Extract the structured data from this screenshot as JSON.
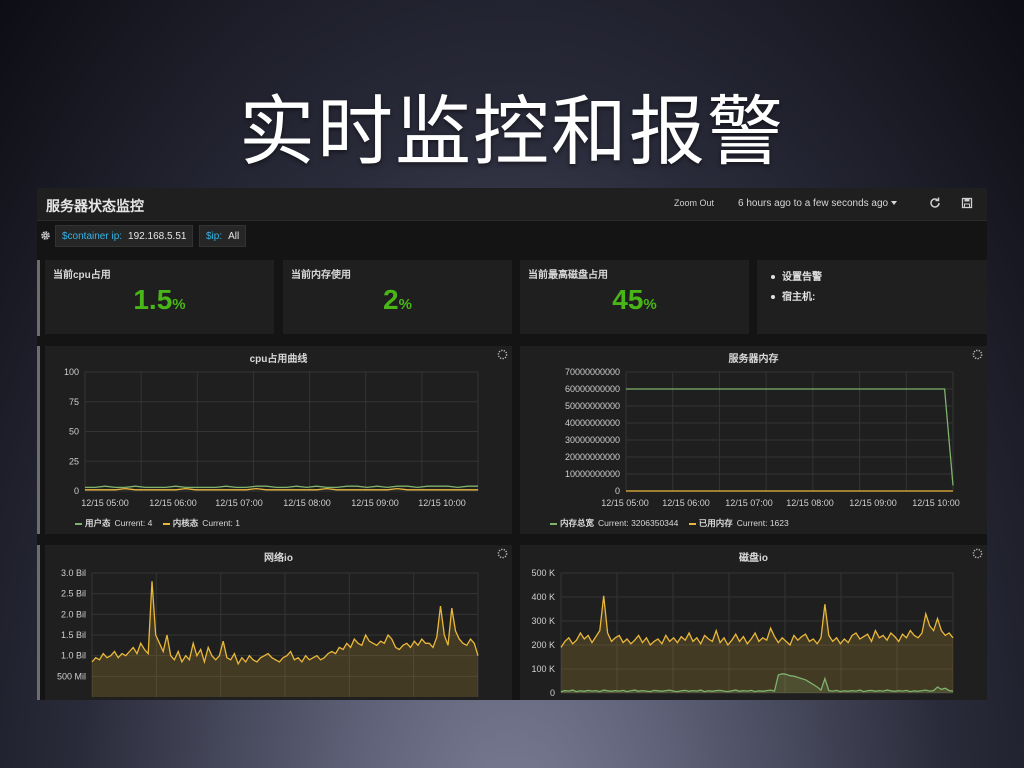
{
  "slide": {
    "title": "实时监控和报警"
  },
  "navbar": {
    "dashboard_title": "服务器状态监控",
    "zoom_out": "Zoom Out",
    "time_range": "6 hours ago to a few seconds ago",
    "refresh_icon": "refresh-icon",
    "save_icon": "save-icon"
  },
  "variables": [
    {
      "label": "$container ip:",
      "value": "192.168.5.51"
    },
    {
      "label": "$ip:",
      "value": "All"
    }
  ],
  "stats": [
    {
      "title": "当前cpu占用",
      "value": "1.5",
      "unit": "%"
    },
    {
      "title": "当前内存使用",
      "value": "2",
      "unit": "%"
    },
    {
      "title": "当前最高磁盘占用",
      "value": "45",
      "unit": "%"
    }
  ],
  "alerts": {
    "items": [
      "设置告警",
      "宿主机:"
    ]
  },
  "colors": {
    "green": "#7eb26d",
    "yellow": "#eab839",
    "stat": "#49b617"
  },
  "chart_data": [
    {
      "id": "cpu",
      "type": "line",
      "title": "cpu占用曲线",
      "ylim": [
        0,
        100
      ],
      "yticks": [
        "100",
        "75",
        "50",
        "25",
        "0"
      ],
      "xticks": [
        "12/15 05:00",
        "12/15 06:00",
        "12/15 07:00",
        "12/15 08:00",
        "12/15 09:00",
        "12/15 10:00"
      ],
      "series": [
        {
          "name": "用户态",
          "current": "Current: 4",
          "color": "#7eb26d",
          "values": [
            3,
            3,
            4,
            3,
            3,
            4,
            3,
            3,
            3,
            4,
            3,
            3,
            3,
            3,
            4,
            3,
            3,
            4,
            4,
            3,
            3,
            4,
            3,
            4,
            3,
            3,
            4,
            4,
            3,
            4,
            3,
            4,
            4,
            3,
            4,
            4,
            4,
            3,
            4,
            4
          ]
        },
        {
          "name": "内核态",
          "current": "Current: 1",
          "color": "#eab839",
          "values": [
            1,
            1,
            1,
            1,
            2,
            1,
            1,
            1,
            1,
            1,
            2,
            1,
            1,
            1,
            1,
            1,
            1,
            2,
            1,
            1,
            1,
            1,
            1,
            1,
            2,
            1,
            1,
            1,
            1,
            1,
            1,
            2,
            1,
            1,
            1,
            1,
            1,
            1,
            1,
            1
          ]
        }
      ]
    },
    {
      "id": "mem",
      "type": "line",
      "title": "服务器内存",
      "ylim": [
        0,
        70000000000
      ],
      "yticks": [
        "70000000000",
        "60000000000",
        "50000000000",
        "40000000000",
        "30000000000",
        "20000000000",
        "10000000000",
        "0"
      ],
      "xticks": [
        "12/15 05:00",
        "12/15 06:00",
        "12/15 07:00",
        "12/15 08:00",
        "12/15 09:00",
        "12/15 10:00"
      ],
      "series": [
        {
          "name": "内存总宽",
          "current": "Current: 3206350344",
          "color": "#7eb26d",
          "values": [
            60000000000,
            60000000000,
            60000000000,
            60000000000,
            60000000000,
            60000000000,
            60000000000,
            60000000000,
            60000000000,
            60000000000,
            60000000000,
            60000000000,
            60000000000,
            60000000000,
            60000000000,
            60000000000,
            60000000000,
            60000000000,
            60000000000,
            60000000000,
            60000000000,
            60000000000,
            60000000000,
            60000000000,
            60000000000,
            60000000000,
            60000000000,
            60000000000,
            60000000000,
            60000000000,
            60000000000,
            60000000000,
            60000000000,
            60000000000,
            60000000000,
            60000000000,
            60000000000,
            60000000000,
            60000000000,
            3206350344
          ]
        },
        {
          "name": "已用内存",
          "current": "Current: 1623",
          "color": "#eab839",
          "values": [
            0,
            0,
            0,
            0,
            0,
            0,
            0,
            0,
            0,
            0,
            0,
            0,
            0,
            0,
            0,
            0,
            0,
            0,
            0,
            0,
            0,
            0,
            0,
            0,
            0,
            0,
            0,
            0,
            0,
            0,
            0,
            0,
            0,
            0,
            0,
            0,
            0,
            0,
            0,
            0
          ]
        }
      ]
    },
    {
      "id": "net",
      "type": "area",
      "title": "网络io",
      "ylim": [
        0,
        3000000000
      ],
      "yticks": [
        "3.0 Bil",
        "2.5 Bil",
        "2.0 Bil",
        "1.5 Bil",
        "1.0 Bil",
        "500 Mil"
      ],
      "series": [
        {
          "name": "",
          "color": "#eab839",
          "values": [
            0.85,
            0.95,
            0.9,
            1.05,
            0.95,
            1.0,
            1.1,
            0.95,
            1.05,
            1.0,
            1.1,
            1.2,
            1.05,
            1.3,
            1.15,
            1.05,
            2.8,
            1.5,
            1.3,
            1.1,
            1.5,
            1.0,
            0.9,
            1.1,
            0.85,
            1.0,
            0.9,
            1.3,
            1.0,
            1.15,
            0.85,
            1.2,
            1.0,
            0.9,
            1.0,
            1.35,
            0.95,
            0.9,
            1.05,
            0.8,
            0.95,
            0.85,
            1.0,
            0.9,
            0.85,
            0.95,
            1.0,
            1.05,
            0.95,
            0.9,
            0.85,
            0.95,
            1.0,
            1.1,
            0.9,
            0.95,
            0.85,
            1.0,
            0.9,
            0.95,
            1.0,
            0.9,
            0.95,
            1.05,
            1.1,
            1.05,
            1.2,
            1.15,
            1.3,
            1.2,
            1.4,
            1.3,
            1.25,
            1.5,
            1.35,
            1.3,
            1.25,
            1.35,
            1.3,
            1.5,
            1.4,
            1.2,
            1.15,
            1.25,
            1.3,
            1.2,
            1.35,
            1.25,
            1.4,
            1.3,
            1.3,
            1.2,
            1.45,
            2.2,
            1.5,
            1.25,
            2.15,
            1.6,
            1.4,
            1.3,
            1.25,
            1.4,
            1.3,
            1.0
          ]
        }
      ]
    },
    {
      "id": "disk",
      "type": "area",
      "title": "磁盘io",
      "ylim": [
        0,
        500000
      ],
      "yticks": [
        "500 K",
        "400 K",
        "300 K",
        "200 K",
        "100 K",
        "0"
      ],
      "series": [
        {
          "name": "",
          "color": "#eab839",
          "values": [
            190,
            215,
            230,
            205,
            220,
            250,
            225,
            240,
            210,
            235,
            260,
            405,
            250,
            215,
            230,
            240,
            210,
            225,
            205,
            220,
            240,
            210,
            230,
            200,
            215,
            225,
            205,
            240,
            215,
            230,
            210,
            235,
            220,
            250,
            215,
            230,
            205,
            240,
            225,
            215,
            260,
            210,
            230,
            200,
            220,
            245,
            215,
            235,
            205,
            225,
            250,
            215,
            230,
            220,
            270,
            235,
            210,
            230,
            215,
            200,
            240,
            220,
            235,
            245,
            215,
            225,
            205,
            230,
            370,
            240,
            215,
            230,
            205,
            225,
            210,
            240,
            250,
            225,
            235,
            245,
            215,
            260,
            230,
            240,
            220,
            250,
            235,
            215,
            245,
            230,
            260,
            240,
            230,
            250,
            330,
            280,
            260,
            310,
            260,
            240,
            250,
            230
          ]
        },
        {
          "name": "",
          "color": "#7eb26d",
          "values": [
            5,
            10,
            8,
            12,
            6,
            9,
            7,
            11,
            8,
            10,
            6,
            12,
            9,
            7,
            10,
            8,
            11,
            6,
            9,
            12,
            7,
            10,
            8,
            6,
            11,
            9,
            7,
            10,
            12,
            8,
            6,
            9,
            11,
            7,
            10,
            8,
            12,
            6,
            9,
            7,
            10,
            11,
            8,
            6,
            9,
            12,
            7,
            10,
            8,
            11,
            6,
            9,
            7,
            10,
            12,
            8,
            75,
            80,
            78,
            72,
            70,
            65,
            60,
            55,
            45,
            35,
            25,
            12,
            60,
            10,
            8,
            11,
            6,
            9,
            7,
            10,
            8,
            12,
            6,
            9,
            11,
            7,
            10,
            8,
            12,
            9,
            7,
            10,
            8,
            11,
            6,
            9,
            7,
            10,
            12,
            8,
            10,
            25,
            15,
            20,
            10,
            8
          ]
        }
      ]
    }
  ]
}
